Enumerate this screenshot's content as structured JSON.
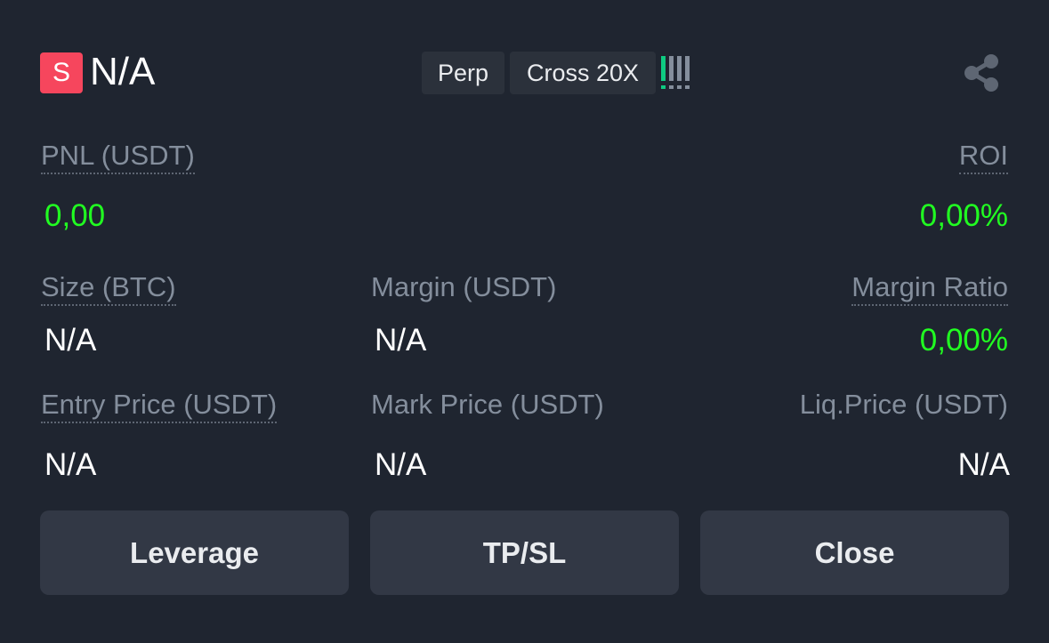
{
  "header": {
    "side_badge": "S",
    "symbol": "N/A",
    "tags": [
      "Perp",
      "Cross 20X"
    ],
    "share_icon": "share-icon",
    "risk_bars_active": 1,
    "risk_bars_total": 5
  },
  "colors": {
    "short_badge": "#f6465d",
    "positive": "#21ff21",
    "label": "#848e9c",
    "button_bg": "#323845"
  },
  "pnl": {
    "label": "PNL (USDT)",
    "value": "0,00"
  },
  "roi": {
    "label": "ROI",
    "value": "0,00%"
  },
  "size": {
    "label": "Size (BTC)",
    "value": "N/A"
  },
  "margin": {
    "label": "Margin (USDT)",
    "value": "N/A"
  },
  "margin_ratio": {
    "label": "Margin Ratio",
    "value": "0,00%"
  },
  "entry_price": {
    "label": "Entry Price (USDT)",
    "value": "N/A"
  },
  "mark_price": {
    "label": "Mark Price (USDT)",
    "value": "N/A"
  },
  "liq_price": {
    "label": "Liq.Price (USDT)",
    "value": "N/A"
  },
  "buttons": {
    "leverage": "Leverage",
    "tpsl": "TP/SL",
    "close": "Close"
  }
}
